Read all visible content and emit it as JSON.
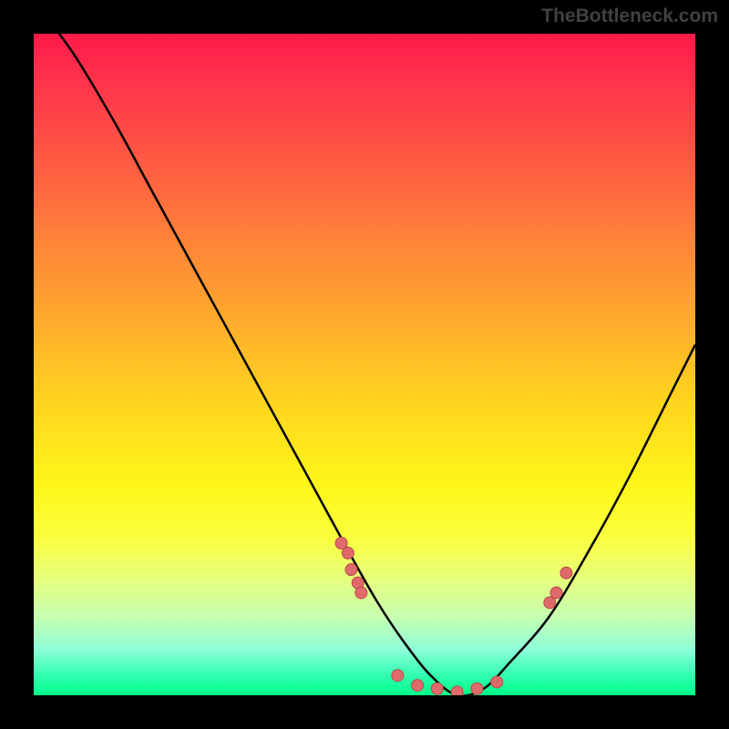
{
  "watermark": "TheBottleneck.com",
  "chart_data": {
    "type": "line",
    "title": "",
    "xlabel": "",
    "ylabel": "",
    "xlim": [
      0,
      100
    ],
    "ylim": [
      0,
      100
    ],
    "curve": {
      "name": "bottleneck-curve",
      "x": [
        0,
        6,
        12,
        18,
        24,
        30,
        36,
        42,
        48,
        52,
        56,
        60,
        64,
        68,
        72,
        78,
        84,
        90,
        96,
        100
      ],
      "y": [
        105,
        97,
        87,
        76,
        65,
        54,
        43,
        32,
        21,
        14,
        8,
        3,
        0,
        1,
        5,
        12,
        22,
        33,
        45,
        53
      ]
    },
    "markers": {
      "name": "sample-points",
      "x": [
        46.5,
        47.5,
        48,
        49,
        49.5,
        55,
        58,
        61,
        64,
        67,
        70,
        78,
        79,
        80.5
      ],
      "y": [
        23,
        21.5,
        19,
        17,
        15.5,
        3,
        1.5,
        1,
        0.5,
        1,
        2,
        14,
        15.5,
        18.5
      ]
    },
    "gradient_colors": {
      "top": "#ff1a4a",
      "mid": "#fff61a",
      "bottom": "#00ff88"
    }
  }
}
